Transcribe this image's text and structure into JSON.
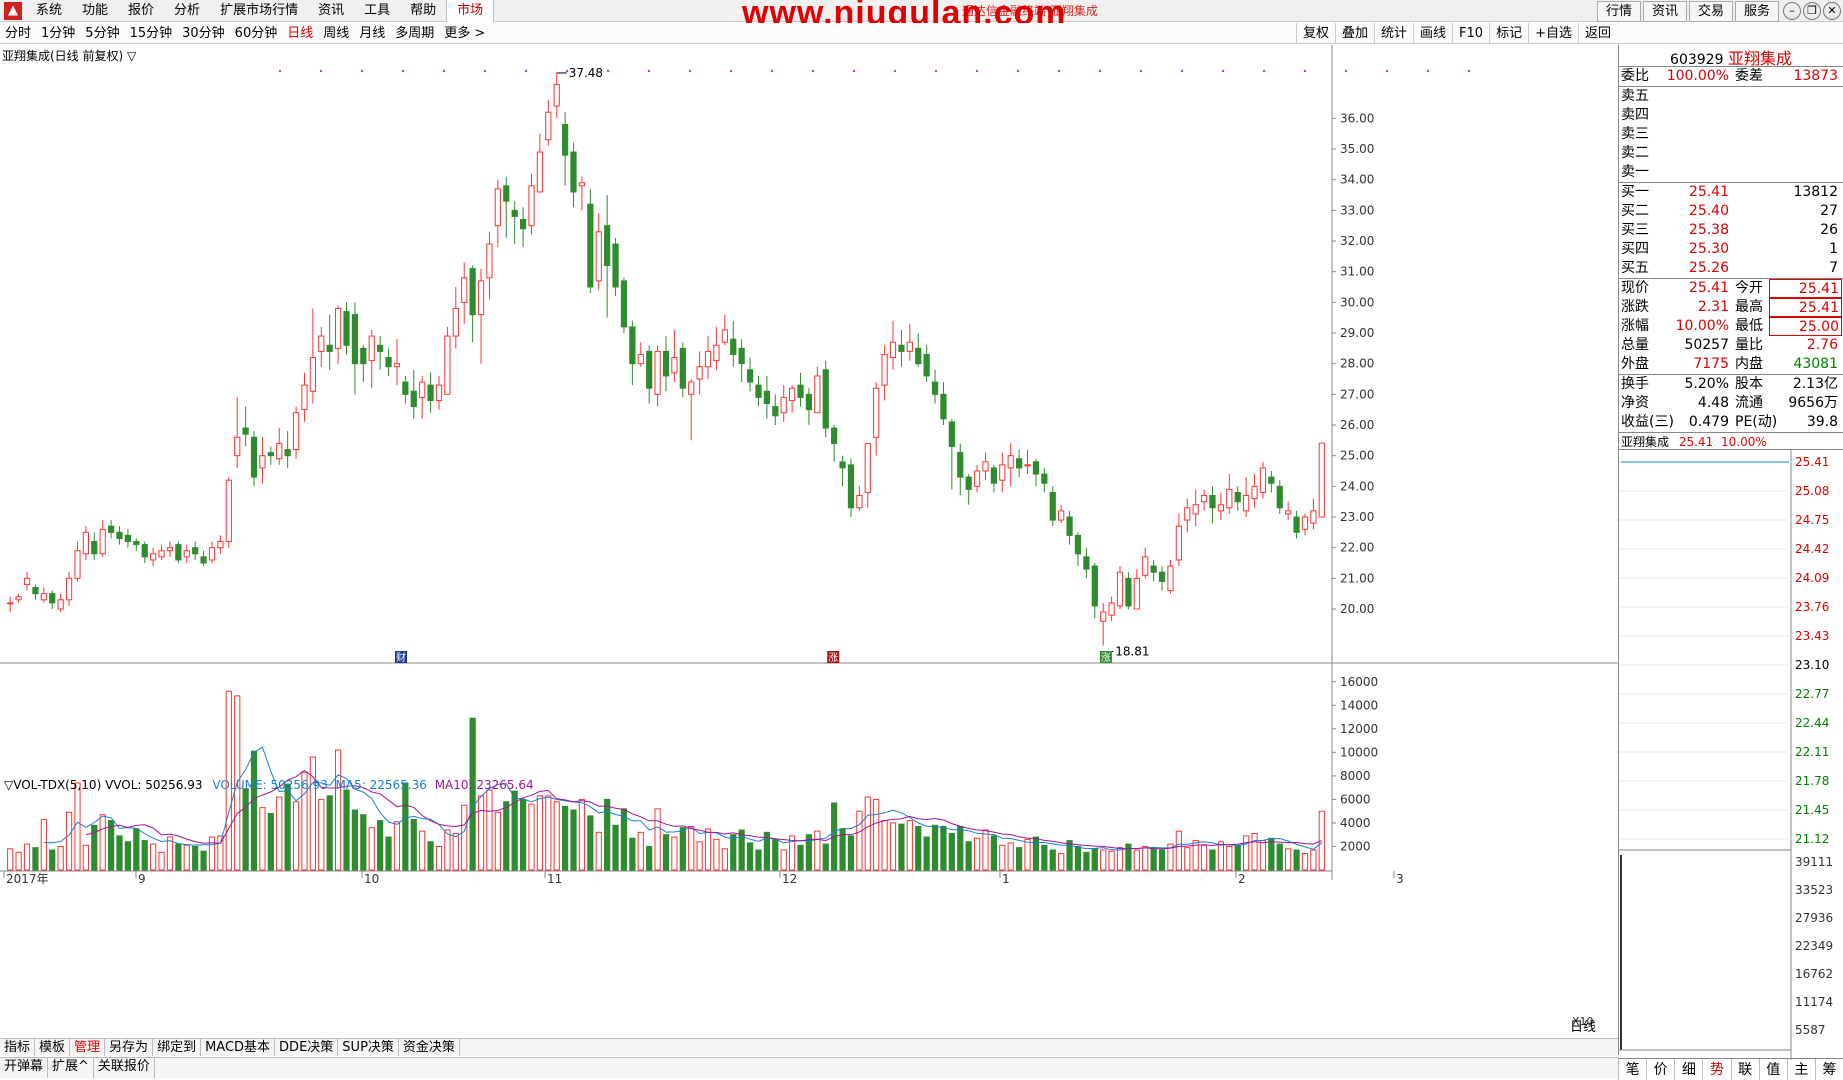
{
  "menu": {
    "items": [
      "系统",
      "功能",
      "报价",
      "分析",
      "扩展市场行情",
      "资讯",
      "工具",
      "帮助"
    ],
    "active": "市场"
  },
  "watermark": "www.niugulan.com",
  "window_title": "通达信金融终端 亚翔集成",
  "topright": {
    "buttons": [
      "行情",
      "资讯",
      "交易",
      "服务"
    ]
  },
  "periods": [
    "分时",
    "1分钟",
    "5分钟",
    "15分钟",
    "30分钟",
    "60分钟",
    "日线",
    "周线",
    "月线",
    "多周期",
    "更多 >"
  ],
  "active_period": "日线",
  "tools": [
    "复权",
    "叠加",
    "统计",
    "画线",
    "F10",
    "标记",
    "+自选",
    "返回"
  ],
  "chart_header": "亚翔集成(日线 前复权) ▽",
  "volume_header": {
    "name": "▽VOL-TDX(5,10) VVOL: 50256.93",
    "volume": "VOLUME: 50256.93",
    "ma5": "MA5: 22565.36",
    "ma10": "MA10: 23265.64"
  },
  "chart_data": {
    "type": "candlestick",
    "price_axis": [
      "36.00",
      "35.00",
      "34.00",
      "33.00",
      "32.00",
      "31.00",
      "30.00",
      "29.00",
      "28.00",
      "27.00",
      "26.00",
      "25.00",
      "24.00",
      "23.00",
      "22.00",
      "21.00",
      "20.00"
    ],
    "volume_axis": [
      "16000",
      "14000",
      "12000",
      "10000",
      "8000",
      "6000",
      "4000",
      "2000"
    ],
    "x_labels": [
      "2017年",
      "9",
      "10",
      "11",
      "12",
      "1",
      "2",
      "3"
    ],
    "annotations": {
      "high": "37.48",
      "low": "18.81"
    },
    "markers": [
      "财",
      "涨",
      "涨"
    ],
    "colors": {
      "up": "#ff3333",
      "down": "#2e8b2e",
      "ma5": "#1a7fd4",
      "ma10": "#a0149c"
    },
    "candles": [
      [
        20.2,
        20.2,
        19.9,
        20.4,
        1800
      ],
      [
        20.3,
        20.4,
        20.2,
        20.5,
        1500
      ],
      [
        20.8,
        21.0,
        20.6,
        21.2,
        2200
      ],
      [
        20.7,
        20.5,
        20.3,
        20.8,
        1900
      ],
      [
        20.3,
        20.5,
        20.2,
        20.7,
        4300
      ],
      [
        20.5,
        20.2,
        20.0,
        20.6,
        1700
      ],
      [
        20.0,
        20.3,
        19.9,
        20.5,
        2000
      ],
      [
        20.3,
        21.0,
        20.1,
        21.2,
        4900
      ],
      [
        21.0,
        21.9,
        20.9,
        22.2,
        7400
      ],
      [
        21.8,
        22.5,
        21.6,
        22.7,
        2100
      ],
      [
        22.2,
        21.8,
        21.6,
        22.5,
        3800
      ],
      [
        21.8,
        22.6,
        21.7,
        22.9,
        4700
      ],
      [
        22.7,
        22.5,
        22.3,
        22.9,
        4200
      ],
      [
        22.5,
        22.3,
        22.1,
        22.7,
        2900
      ],
      [
        22.4,
        22.2,
        22.0,
        22.6,
        2400
      ],
      [
        22.2,
        22.1,
        21.9,
        22.3,
        3500
      ],
      [
        22.1,
        21.7,
        21.5,
        22.2,
        2500
      ],
      [
        21.6,
        21.8,
        21.4,
        22.0,
        2200
      ],
      [
        21.7,
        21.9,
        21.6,
        22.1,
        1500
      ],
      [
        21.9,
        22.0,
        21.7,
        22.2,
        2800
      ],
      [
        22.1,
        21.6,
        21.5,
        22.2,
        2200
      ],
      [
        21.7,
        21.9,
        21.5,
        22.1,
        2100
      ],
      [
        22.0,
        21.8,
        21.6,
        22.2,
        2000
      ],
      [
        21.7,
        21.5,
        21.4,
        21.9,
        1600
      ],
      [
        21.6,
        22.0,
        21.5,
        22.2,
        2800
      ],
      [
        22.0,
        22.2,
        21.8,
        22.4,
        2900
      ],
      [
        22.2,
        24.2,
        22.0,
        24.3,
        15200
      ],
      [
        25.0,
        25.6,
        24.6,
        26.9,
        14800
      ],
      [
        25.9,
        25.7,
        25.3,
        26.6,
        6900
      ],
      [
        25.6,
        24.3,
        24.0,
        25.8,
        10100
      ],
      [
        24.6,
        25.0,
        24.1,
        25.6,
        5300
      ],
      [
        25.1,
        25.0,
        24.7,
        25.3,
        4800
      ],
      [
        24.9,
        25.4,
        24.7,
        25.9,
        6200
      ],
      [
        25.2,
        25.0,
        24.6,
        25.8,
        7300
      ],
      [
        25.2,
        26.4,
        24.9,
        26.6,
        5800
      ],
      [
        26.5,
        27.3,
        26.1,
        27.7,
        8300
      ],
      [
        27.1,
        28.2,
        26.7,
        29.8,
        9600
      ],
      [
        28.4,
        28.9,
        27.9,
        29.2,
        6000
      ],
      [
        28.6,
        28.4,
        27.8,
        29.6,
        6300
      ],
      [
        28.5,
        29.8,
        28.0,
        29.9,
        10200
      ],
      [
        29.7,
        28.6,
        28.3,
        30.0,
        6800
      ],
      [
        29.6,
        28.0,
        27.0,
        30.0,
        5100
      ],
      [
        28.5,
        28.0,
        27.4,
        28.6,
        4700
      ],
      [
        28.1,
        28.9,
        27.2,
        29.1,
        3600
      ],
      [
        28.6,
        28.4,
        27.8,
        28.9,
        4200
      ],
      [
        28.2,
        27.9,
        27.6,
        28.5,
        2800
      ],
      [
        27.9,
        28.0,
        27.3,
        28.8,
        4100
      ],
      [
        27.4,
        27.0,
        26.7,
        27.6,
        7400
      ],
      [
        27.1,
        26.6,
        26.2,
        27.8,
        4300
      ],
      [
        26.9,
        27.4,
        26.2,
        27.6,
        3300
      ],
      [
        27.3,
        26.8,
        26.4,
        27.7,
        2400
      ],
      [
        26.8,
        27.3,
        26.5,
        27.6,
        2000
      ],
      [
        27.0,
        28.9,
        27.0,
        29.2,
        3400
      ],
      [
        28.9,
        29.8,
        28.5,
        30.5,
        3100
      ],
      [
        30.0,
        30.8,
        29.3,
        31.3,
        5500
      ],
      [
        31.1,
        29.6,
        28.7,
        31.2,
        12900
      ],
      [
        29.6,
        30.7,
        28.0,
        31.1,
        6300
      ],
      [
        30.8,
        31.9,
        30.1,
        32.3,
        6800
      ],
      [
        32.5,
        33.7,
        31.8,
        34.0,
        4900
      ],
      [
        33.8,
        33.3,
        32.1,
        34.1,
        5800
      ],
      [
        33.0,
        32.8,
        31.9,
        33.3,
        6700
      ],
      [
        32.7,
        32.4,
        31.8,
        33.1,
        6000
      ],
      [
        32.5,
        33.8,
        32.2,
        34.2,
        5600
      ],
      [
        33.6,
        34.9,
        33.6,
        35.5,
        6300
      ],
      [
        35.3,
        36.2,
        35.1,
        36.6,
        6300
      ],
      [
        36.4,
        37.1,
        36.0,
        37.48,
        5800
      ],
      [
        35.8,
        34.8,
        33.8,
        36.2,
        5400
      ],
      [
        34.9,
        33.6,
        33.1,
        35.2,
        5100
      ],
      [
        33.8,
        33.9,
        33.0,
        34.1,
        6000
      ],
      [
        33.2,
        30.5,
        30.3,
        33.7,
        4600
      ],
      [
        30.7,
        32.3,
        30.4,
        32.9,
        3200
      ],
      [
        32.5,
        31.2,
        29.5,
        33.5,
        6000
      ],
      [
        31.9,
        30.5,
        30.2,
        32.1,
        3800
      ],
      [
        30.7,
        29.2,
        29.0,
        30.8,
        5200
      ],
      [
        29.2,
        28.0,
        27.3,
        29.4,
        2700
      ],
      [
        28.0,
        28.3,
        27.9,
        28.7,
        3200
      ],
      [
        28.4,
        27.2,
        26.7,
        28.6,
        2000
      ],
      [
        27.0,
        28.4,
        26.6,
        28.6,
        5200
      ],
      [
        28.4,
        27.6,
        27.1,
        28.9,
        3000
      ],
      [
        27.7,
        28.2,
        27.4,
        29.1,
        2800
      ],
      [
        28.5,
        27.2,
        26.9,
        28.7,
        3600
      ],
      [
        27.0,
        27.4,
        25.5,
        27.5,
        3700
      ],
      [
        27.5,
        27.9,
        27.0,
        28.4,
        2400
      ],
      [
        27.9,
        28.4,
        27.5,
        28.9,
        3500
      ],
      [
        28.1,
        28.6,
        27.8,
        29.2,
        2600
      ],
      [
        28.7,
        29.1,
        28.6,
        29.6,
        1800
      ],
      [
        28.8,
        28.3,
        27.9,
        29.4,
        3000
      ],
      [
        28.5,
        28.0,
        27.4,
        28.8,
        3400
      ],
      [
        27.8,
        27.4,
        27.1,
        28.2,
        2300
      ],
      [
        27.3,
        26.9,
        26.6,
        27.6,
        1700
      ],
      [
        27.1,
        26.7,
        26.2,
        27.6,
        3200
      ],
      [
        26.6,
        26.3,
        26.0,
        27.0,
        2600
      ],
      [
        26.4,
        26.9,
        26.1,
        27.3,
        1700
      ],
      [
        26.8,
        27.2,
        26.4,
        27.3,
        2900
      ],
      [
        27.3,
        26.9,
        26.6,
        27.7,
        2100
      ],
      [
        27.0,
        26.5,
        26.0,
        27.2,
        3000
      ],
      [
        26.4,
        27.6,
        26.4,
        27.9,
        3300
      ],
      [
        27.8,
        25.9,
        25.6,
        28.1,
        2200
      ],
      [
        25.9,
        25.4,
        24.8,
        26.0,
        5700
      ],
      [
        24.8,
        24.6,
        24.0,
        25.0,
        3500
      ],
      [
        24.7,
        23.3,
        23.0,
        24.9,
        2900
      ],
      [
        23.3,
        23.7,
        23.2,
        24.0,
        5000
      ],
      [
        23.8,
        25.4,
        23.3,
        25.4,
        6200
      ],
      [
        25.6,
        27.2,
        25.0,
        27.4,
        6000
      ],
      [
        27.3,
        28.3,
        26.8,
        28.6,
        4200
      ],
      [
        28.2,
        28.7,
        27.8,
        29.4,
        4000
      ],
      [
        28.6,
        28.4,
        27.9,
        29.1,
        3900
      ],
      [
        28.4,
        28.7,
        28.1,
        29.3,
        4200
      ],
      [
        28.5,
        28.0,
        27.9,
        29.0,
        3700
      ],
      [
        28.3,
        27.6,
        27.4,
        28.6,
        2800
      ],
      [
        27.4,
        27.0,
        26.7,
        27.8,
        3800
      ],
      [
        27.0,
        26.2,
        26.0,
        27.4,
        3700
      ],
      [
        26.1,
        25.3,
        23.9,
        26.2,
        3100
      ],
      [
        25.1,
        24.3,
        23.7,
        25.4,
        3700
      ],
      [
        24.3,
        23.9,
        23.4,
        24.4,
        2400
      ],
      [
        24.0,
        24.5,
        23.8,
        24.7,
        2700
      ],
      [
        24.5,
        24.8,
        24.2,
        25.1,
        3400
      ],
      [
        24.6,
        24.1,
        23.8,
        24.7,
        2900
      ],
      [
        24.2,
        24.7,
        23.8,
        25.1,
        2100
      ],
      [
        24.6,
        25.0,
        24.0,
        25.4,
        2300
      ],
      [
        24.9,
        24.6,
        24.3,
        25.2,
        1900
      ],
      [
        24.7,
        24.7,
        24.4,
        25.2,
        2600
      ],
      [
        24.8,
        24.4,
        24.0,
        24.9,
        2800
      ],
      [
        24.4,
        24.1,
        23.8,
        24.6,
        2100
      ],
      [
        23.8,
        22.9,
        22.7,
        24.0,
        1700
      ],
      [
        22.9,
        23.2,
        22.8,
        23.4,
        1400
      ],
      [
        23.0,
        22.4,
        22.1,
        23.2,
        2500
      ],
      [
        22.4,
        21.8,
        21.4,
        22.5,
        2000
      ],
      [
        21.7,
        21.3,
        21.0,
        22.0,
        1500
      ],
      [
        21.4,
        20.1,
        19.7,
        21.5,
        1800
      ],
      [
        19.6,
        19.9,
        18.81,
        20.2,
        1700
      ],
      [
        19.8,
        20.2,
        19.6,
        20.4,
        1600
      ],
      [
        20.1,
        21.2,
        20.0,
        21.4,
        1900
      ],
      [
        21.0,
        20.1,
        20.0,
        21.2,
        2200
      ],
      [
        20.0,
        21.0,
        20.0,
        21.3,
        1700
      ],
      [
        21.1,
        21.7,
        21.0,
        22.0,
        2000
      ],
      [
        21.4,
        21.2,
        20.9,
        21.6,
        1800
      ],
      [
        21.2,
        20.9,
        20.6,
        21.4,
        1700
      ],
      [
        20.6,
        21.4,
        20.5,
        21.6,
        2200
      ],
      [
        21.6,
        22.7,
        21.4,
        23.1,
        3300
      ],
      [
        22.9,
        23.3,
        22.5,
        23.6,
        1900
      ],
      [
        23.1,
        23.4,
        22.7,
        23.9,
        2500
      ],
      [
        23.5,
        23.7,
        23.2,
        23.9,
        2100
      ],
      [
        23.7,
        23.3,
        22.8,
        24.0,
        1700
      ],
      [
        23.2,
        23.4,
        22.9,
        23.8,
        2400
      ],
      [
        23.3,
        23.9,
        23.1,
        24.4,
        2000
      ],
      [
        23.8,
        23.5,
        23.2,
        24.0,
        2100
      ],
      [
        23.2,
        23.7,
        23.0,
        24.3,
        2900
      ],
      [
        23.6,
        24.0,
        23.3,
        24.4,
        3100
      ],
      [
        23.8,
        24.6,
        23.6,
        24.8,
        2500
      ],
      [
        24.3,
        24.1,
        23.8,
        24.5,
        2700
      ],
      [
        24.0,
        23.3,
        23.1,
        24.2,
        2200
      ],
      [
        23.1,
        23.2,
        22.9,
        23.5,
        1800
      ],
      [
        23.0,
        22.5,
        22.3,
        23.2,
        1700
      ],
      [
        22.6,
        23.0,
        22.4,
        23.1,
        1400
      ],
      [
        22.8,
        23.2,
        22.6,
        23.6,
        1700
      ],
      [
        23.0,
        25.41,
        23.0,
        25.41,
        5000
      ]
    ]
  },
  "panel": {
    "code": "603929",
    "name": "亚翔集成",
    "weibi_label": "委比",
    "weibi": "100.00%",
    "weicha_label": "委差",
    "weicha": "13873",
    "asks": [
      {
        "label": "卖五"
      },
      {
        "label": "卖四"
      },
      {
        "label": "卖三"
      },
      {
        "label": "卖二"
      },
      {
        "label": "卖一"
      }
    ],
    "bids": [
      {
        "label": "买一",
        "price": "25.41",
        "vol": "13812"
      },
      {
        "label": "买二",
        "price": "25.40",
        "vol": "27"
      },
      {
        "label": "买三",
        "price": "25.38",
        "vol": "26"
      },
      {
        "label": "买四",
        "price": "25.30",
        "vol": "1"
      },
      {
        "label": "买五",
        "price": "25.26",
        "vol": "7"
      }
    ],
    "stats": [
      {
        "k1": "现价",
        "v1": "25.41",
        "k2": "今开",
        "v2": "25.41"
      },
      {
        "k1": "涨跌",
        "v1": "2.31",
        "k2": "最高",
        "v2": "25.41"
      },
      {
        "k1": "涨幅",
        "v1": "10.00%",
        "k2": "最低",
        "v2": "25.00"
      },
      {
        "k1": "总量",
        "v1": "50257",
        "k2": "量比",
        "v2": "2.76"
      },
      {
        "k1": "外盘",
        "v1": "7175",
        "k2": "内盘",
        "v2": "43081"
      }
    ],
    "stats2": [
      {
        "k1": "换手",
        "v1": "5.20%",
        "k2": "股本",
        "v2": "2.13亿"
      },
      {
        "k1": "净资",
        "v1": "4.48",
        "k2": "流通",
        "v2": "9656万"
      },
      {
        "k1": "收益(三)",
        "v1": "0.479",
        "k2": "PE(动)",
        "v2": "39.8"
      }
    ],
    "mini_header": {
      "name": "亚翔集成",
      "price": "25.41",
      "pct": "10.00%"
    },
    "mini_axis": [
      "25.41",
      "25.08",
      "24.75",
      "24.42",
      "24.09",
      "23.76",
      "23.43",
      "23.10",
      "22.77",
      "22.44",
      "22.11",
      "21.78",
      "21.45",
      "21.12"
    ],
    "mini_vol_axis": [
      "39111",
      "33523",
      "27936",
      "22349",
      "16762",
      "11174",
      "5587"
    ],
    "bottom_tabs": [
      "笔",
      "价",
      "细",
      "势",
      "联",
      "值",
      "主",
      "筹"
    ],
    "active_bottom_tab": "势"
  },
  "tabs_row1": [
    "指标",
    "模板",
    "管理",
    "另存为",
    "绑定到",
    "MACD基本",
    "DDE决策",
    "SUP决策",
    "资金决策"
  ],
  "tabs_row1_active": "管理",
  "tabs_row2": [
    "开弹幕",
    "扩展^",
    "关联报价"
  ],
  "daily_label": "日线",
  "x10_label": "X10"
}
